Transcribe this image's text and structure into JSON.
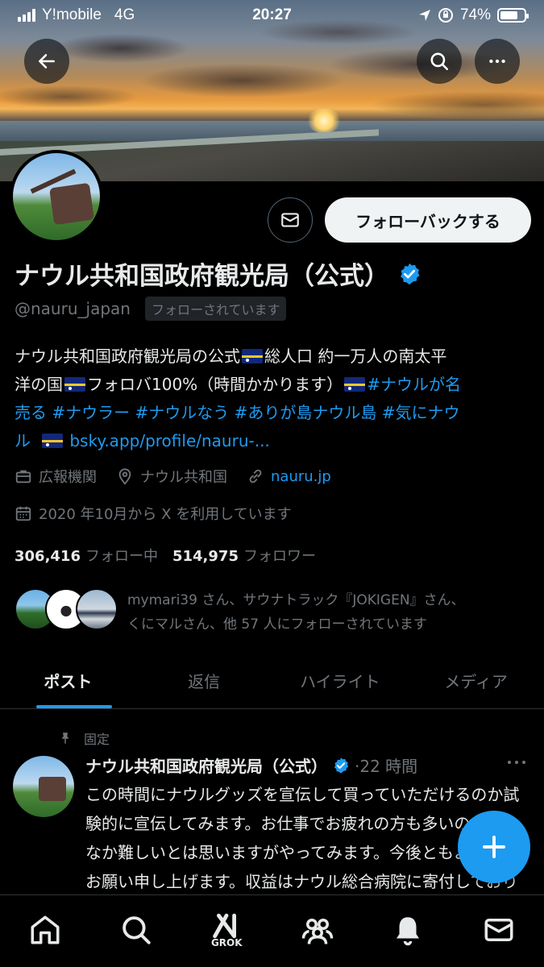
{
  "status_bar": {
    "carrier": "Y!mobile",
    "network": "4G",
    "time": "20:27",
    "battery": "74%",
    "battery_level": 0.74
  },
  "profile": {
    "display_name": "ナウル共和国政府観光局（公式）",
    "handle": "@nauru_japan",
    "follows_you": "フォローされています",
    "follow_back_label": "フォローバックする",
    "bio": {
      "line1_a": "ナウル共和国政府観光局の公式",
      "line1_b": "総人口 約一万人の南太平",
      "line2_a": "洋の国",
      "line2_b": "フォロバ100%（時間かかります）",
      "hashtag1": "#ナウルが名",
      "line3_a": "売る",
      "hashtag2": "#ナウラー",
      "hashtag3": "#ナウルなう",
      "hashtag4": "#ありが島ナウル島",
      "hashtag5": "#気にナウ",
      "line4_a": "ル",
      "link": "bsky.app/profile/nauru-..."
    },
    "category": "広報機関",
    "location": "ナウル共和国",
    "website": "nauru.jp",
    "joined": "2020 年10月から X を利用しています",
    "following_count": "306,416",
    "following_label": "フォロー中",
    "followers_count": "514,975",
    "followers_label": "フォロワー",
    "known_followers_line1": "mymari39 さん、サウナトラック『JOKIGEN』さん、",
    "known_followers_line2": "くにマルさん、他 57 人にフォローされています"
  },
  "tabs": [
    {
      "label": "ポスト",
      "active": true
    },
    {
      "label": "返信",
      "active": false
    },
    {
      "label": "ハイライト",
      "active": false
    },
    {
      "label": "メディア",
      "active": false
    }
  ],
  "pinned_post": {
    "pinned_label": "固定",
    "author": "ナウル共和国政府観光局（公式）",
    "time": "·22 時間",
    "text": "この時間にナウルグッズを宣伝して買っていただけるのか試験的に宣伝してみます。お仕事でお疲れの方も多いのでなかなか難しいとは思いますがやってみます。今後ともよろしくお願い申し上げます。収益はナウル総合病院に寄付しております。"
  },
  "bottom_nav": {
    "grok_label": "GROK",
    "icons": [
      "home-icon",
      "search-icon",
      "grok-icon",
      "communities-icon",
      "notifications-icon",
      "messages-icon"
    ]
  },
  "colors": {
    "accent": "#1d9bf0",
    "background": "#000000",
    "muted": "#71767b",
    "text": "#e7e9ea"
  }
}
